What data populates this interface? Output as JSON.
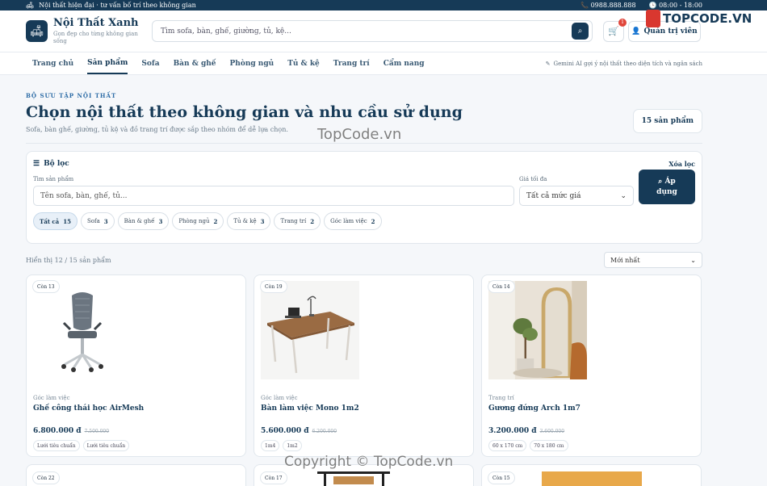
{
  "topbar": {
    "left_text": "Nội thất hiện đại · tư vấn bố trí theo không gian",
    "phone": "0988.888.888",
    "hours": "08:00 - 18:00"
  },
  "header": {
    "brand_name": "Nội Thất Xanh",
    "brand_tagline": "Gọn đẹp cho từng không gian sống",
    "search_placeholder": "Tìm sofa, bàn, ghế, giường, tủ, kệ...",
    "cart_count": "1",
    "admin_label": "Quản trị viên"
  },
  "nav": {
    "items": [
      "Trang chủ",
      "Sản phẩm",
      "Sofa",
      "Bàn & ghế",
      "Phòng ngủ",
      "Tủ & kệ",
      "Trang trí",
      "Cẩm nang"
    ],
    "active_index": 1,
    "ai_hint": "Gemini AI gợi ý nội thất theo diện tích và ngân sách"
  },
  "hero": {
    "eyebrow": "BỘ SƯU TẬP NỘI THẤT",
    "title": "Chọn nội thất theo không gian và nhu cầu sử dụng",
    "desc": "Sofa, bàn ghế, giường, tủ kệ và đồ trang trí được sắp theo nhóm để dễ lựa chọn.",
    "count": "15 sản phẩm"
  },
  "filter": {
    "title": "Bộ lọc",
    "clear": "Xóa lọc",
    "name_label": "Tìm sản phẩm",
    "name_placeholder": "Tên sofa, bàn, ghế, tủ...",
    "price_label": "Giá tối đa",
    "price_value": "Tất cả mức giá",
    "apply_line1": "Áp",
    "apply_line2": "dụng",
    "chips": [
      {
        "label": "Tất cả",
        "count": "15"
      },
      {
        "label": "Sofa",
        "count": "3"
      },
      {
        "label": "Bàn & ghế",
        "count": "3"
      },
      {
        "label": "Phòng ngủ",
        "count": "2"
      },
      {
        "label": "Tủ & kệ",
        "count": "3"
      },
      {
        "label": "Trang trí",
        "count": "2"
      },
      {
        "label": "Góc làm việc",
        "count": "2"
      }
    ]
  },
  "results": {
    "text": "Hiển thị 12 / 15 sản phẩm",
    "sort": "Mới nhất"
  },
  "products": [
    {
      "stock": "Còn 13",
      "category": "Góc làm việc",
      "name": "Ghế công thái học AirMesh",
      "price": "6.800.000 đ",
      "old_price": "7.500.000",
      "tags": [
        "Lưới tiêu chuẩn",
        "Lưới tiêu chuẩn"
      ]
    },
    {
      "stock": "Còn 19",
      "category": "Góc làm việc",
      "name": "Bàn làm việc Mono 1m2",
      "price": "5.600.000 đ",
      "old_price": "6.200.000",
      "tags": [
        "1m4",
        "1m2"
      ]
    },
    {
      "stock": "Còn 14",
      "category": "Trang trí",
      "name": "Gương đứng Arch 1m7",
      "price": "3.200.000 đ",
      "old_price": "3.600.000",
      "tags": [
        "60 x 170 cm",
        "70 x 180 cm"
      ]
    }
  ],
  "products_row2": [
    {
      "stock": "Còn 22"
    },
    {
      "stock": "Còn 17"
    },
    {
      "stock": "Còn 15"
    }
  ],
  "watermarks": {
    "logo_text": "TOPCODE.VN",
    "center": "TopCode.vn",
    "bottom": "Copyright © TopCode.vn"
  }
}
